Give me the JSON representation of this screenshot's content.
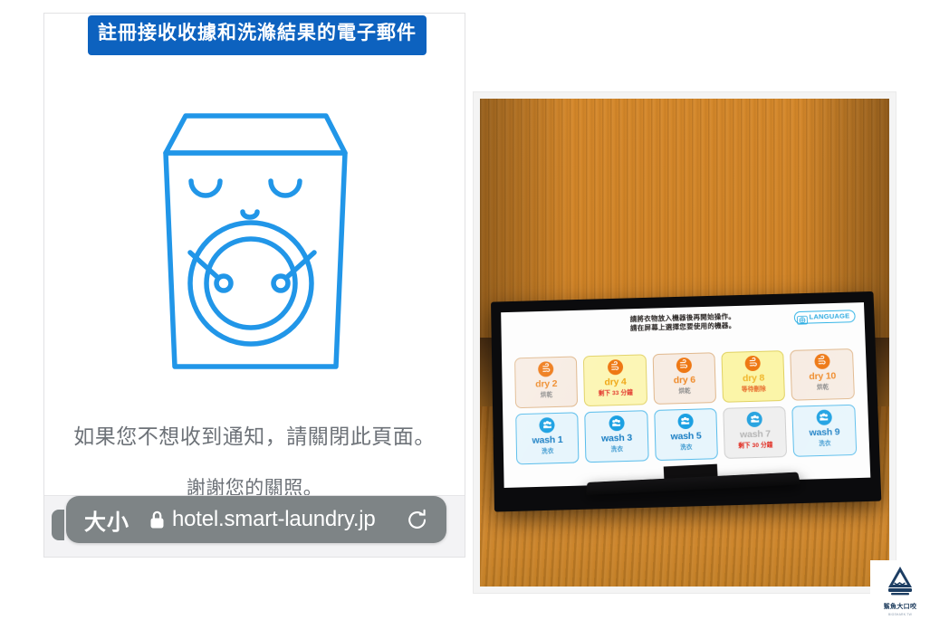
{
  "phone": {
    "cta_label": "註冊接收收據和洗滌結果的電子郵件",
    "mascot_icon": "washing-machine-mascot",
    "notice_primary": "如果您不想收到通知，請關閉此頁面。",
    "notice_secondary": "謝謝您的關照。",
    "browser_bar": {
      "aa_label": "大小",
      "lock_icon": "lock-icon",
      "url": "hotel.smart-laundry.jp",
      "reload_icon": "reload-icon"
    },
    "accent_color": "#0d62bf",
    "mascot_color": "#2196e8"
  },
  "kiosk": {
    "instruction_line1": "請將衣物放入機器後再開始操作。",
    "instruction_line2": "請在屏幕上選擇您要使用的機器。",
    "language_button": {
      "label": "LANGUAGE",
      "icon": "globe-icon",
      "color": "#29a9e0"
    },
    "dryers": [
      {
        "name": "dry 2",
        "status": "烘乾",
        "state": "available",
        "icon": "dryer-heat-icon"
      },
      {
        "name": "dry 4",
        "status": "剩下 33 分鐘",
        "state": "busy",
        "icon": "dryer-heat-icon"
      },
      {
        "name": "dry 6",
        "status": "烘乾",
        "state": "available",
        "icon": "dryer-heat-icon"
      },
      {
        "name": "dry 8",
        "status": "等待刪除",
        "state": "pending",
        "icon": "dryer-heat-icon"
      },
      {
        "name": "dry 10",
        "status": "烘乾",
        "state": "available",
        "icon": "dryer-heat-icon"
      }
    ],
    "washers": [
      {
        "name": "wash 1",
        "status": "洗衣",
        "state": "available",
        "icon": "washer-bubbles-icon"
      },
      {
        "name": "wash 3",
        "status": "洗衣",
        "state": "available",
        "icon": "washer-bubbles-icon"
      },
      {
        "name": "wash 5",
        "status": "洗衣",
        "state": "available",
        "icon": "washer-bubbles-icon"
      },
      {
        "name": "wash 7",
        "status": "剩下 30 分鐘",
        "state": "busy",
        "icon": "washer-bubbles-icon"
      },
      {
        "name": "wash 9",
        "status": "洗衣",
        "state": "available",
        "icon": "washer-bubbles-icon"
      }
    ],
    "dryer_accent": "#ee7814",
    "washer_accent": "#1ba0e2"
  },
  "watermark": {
    "brand": "鯊魚大口咬",
    "subtext": "BIGSHARK.TW",
    "icon": "shark-logo-icon"
  }
}
